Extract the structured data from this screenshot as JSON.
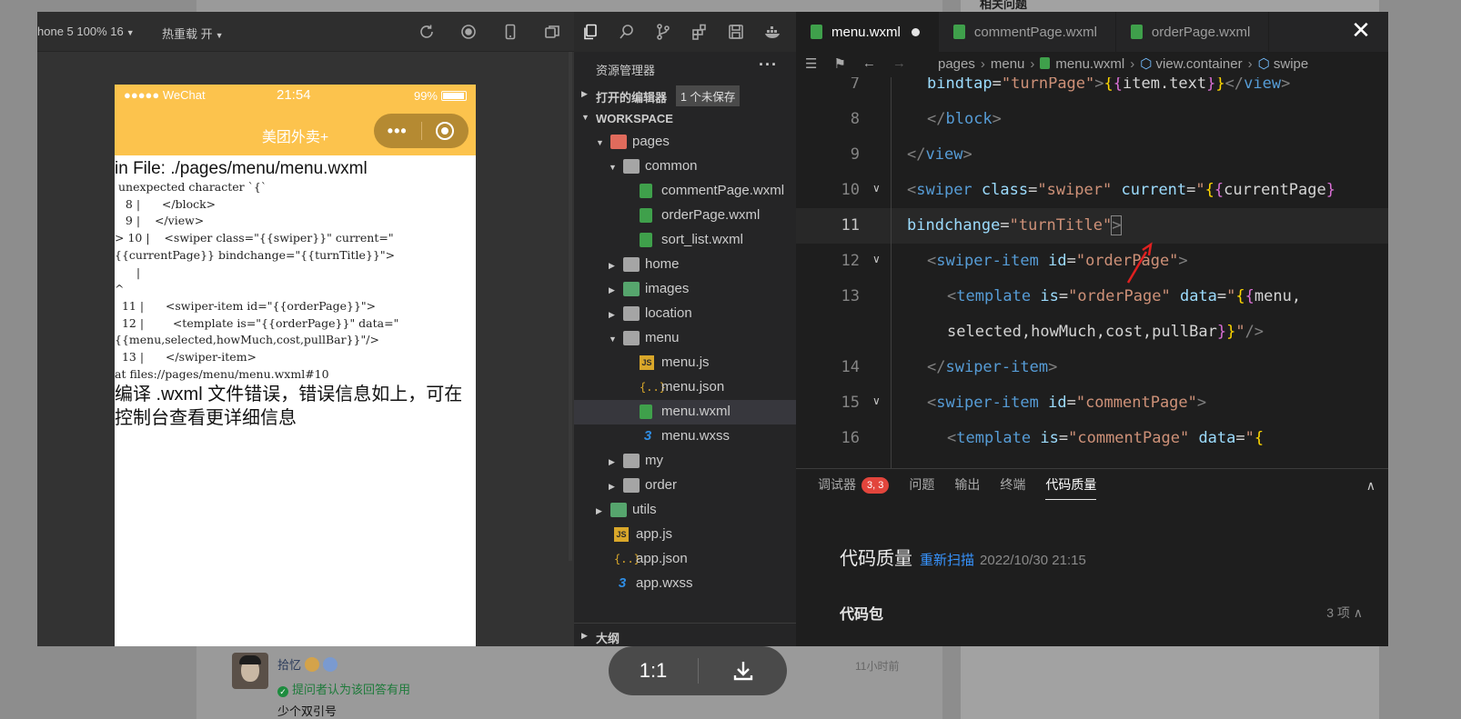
{
  "background": {
    "related_title": "相关问题",
    "answer": {
      "user_name": "拾忆",
      "accepted_text": "提问者认为该回答有用",
      "reply_text": "少个双引号",
      "time": "11小时前"
    }
  },
  "simulator": {
    "device_label": "hone 5 100% 16",
    "hot_reload_label": "热重载 开",
    "tools": [
      "refresh-icon",
      "record-icon",
      "phone-icon",
      "windows-icon"
    ],
    "phone": {
      "carrier": "●●●●● WeChat",
      "time": "21:54",
      "battery": "99%",
      "nav_title": "美团外卖+",
      "error_file": "in File: ./pages/menu/menu.wxml",
      "error_lines": [
        " unexpected character `{`",
        "   8 |      </block>",
        "   9 |    </view>",
        "> 10 |    <swiper class=\"{{swiper}}\" current=\"",
        "{{currentPage}} bindchange=\"{{turnTitle}}\">",
        "      |",
        "^",
        "  11 |      <swiper-item id=\"{{orderPage}}\">",
        "  12 |        <template is=\"{{orderPage}}\" data=\"",
        "{{menu,selected,howMuch,cost,pullBar}}\"/>",
        "  13 |      </swiper-item>",
        "at files://pages/menu/menu.wxml#10"
      ],
      "error_footer": "编译 .wxml 文件错误，错误信息如上，可在控制台查看更详细信息"
    }
  },
  "explorer": {
    "title": "资源管理器",
    "more": "···",
    "open_editors": "打开的编辑器",
    "unsaved_badge": "1 个未保存",
    "workspace": "WORKSPACE",
    "outline": "大纲",
    "tree": [
      {
        "name": "pages",
        "type": "folder-red",
        "depth": 1,
        "expanded": true
      },
      {
        "name": "common",
        "type": "folder",
        "depth": 2,
        "expanded": true
      },
      {
        "name": "commentPage.wxml",
        "type": "wxml",
        "depth": 3
      },
      {
        "name": "orderPage.wxml",
        "type": "wxml",
        "depth": 3
      },
      {
        "name": "sort_list.wxml",
        "type": "wxml",
        "depth": 3
      },
      {
        "name": "home",
        "type": "folder",
        "depth": 2,
        "expanded": false
      },
      {
        "name": "images",
        "type": "folder-green",
        "depth": 2,
        "expanded": false
      },
      {
        "name": "location",
        "type": "folder",
        "depth": 2,
        "expanded": false
      },
      {
        "name": "menu",
        "type": "folder",
        "depth": 2,
        "expanded": true
      },
      {
        "name": "menu.js",
        "type": "js",
        "depth": 3
      },
      {
        "name": "menu.json",
        "type": "json",
        "depth": 3
      },
      {
        "name": "menu.wxml",
        "type": "wxml",
        "depth": 3,
        "selected": true
      },
      {
        "name": "menu.wxss",
        "type": "wxss",
        "depth": 3
      },
      {
        "name": "my",
        "type": "folder",
        "depth": 2,
        "expanded": false
      },
      {
        "name": "order",
        "type": "folder",
        "depth": 2,
        "expanded": false
      },
      {
        "name": "utils",
        "type": "folder-green",
        "depth": 1,
        "expanded": false
      },
      {
        "name": "app.js",
        "type": "js",
        "depth": 1
      },
      {
        "name": "app.json",
        "type": "json",
        "depth": 1
      },
      {
        "name": "app.wxss",
        "type": "wxss",
        "depth": 1
      }
    ]
  },
  "editor": {
    "tabs": [
      {
        "label": "menu.wxml",
        "active": true,
        "dirty": true
      },
      {
        "label": "commentPage.wxml",
        "active": false
      },
      {
        "label": "orderPage.wxml",
        "active": false
      }
    ],
    "close_label": "✕",
    "breadcrumb": [
      "pages",
      "menu",
      "menu.wxml",
      "view.container",
      "swipe"
    ],
    "line_numbers": [
      "7",
      "8",
      "9",
      "10",
      "11",
      "12",
      "13",
      "",
      "14",
      "15",
      "16"
    ],
    "current_line": "11",
    "bottom_panel": {
      "tabs": [
        "调试器",
        "问题",
        "输出",
        "终端",
        "代码质量"
      ],
      "debugger_badge": "3, 3",
      "active_tab": "代码质量",
      "quality_title": "代码质量",
      "rescan_link": "重新扫描",
      "scan_date": "2022/10/30 21:15",
      "package_label": "代码包",
      "package_count": "3 项 ∧"
    }
  },
  "viewer": {
    "zoom_ratio": "1:1",
    "download_icon": "download-icon"
  }
}
